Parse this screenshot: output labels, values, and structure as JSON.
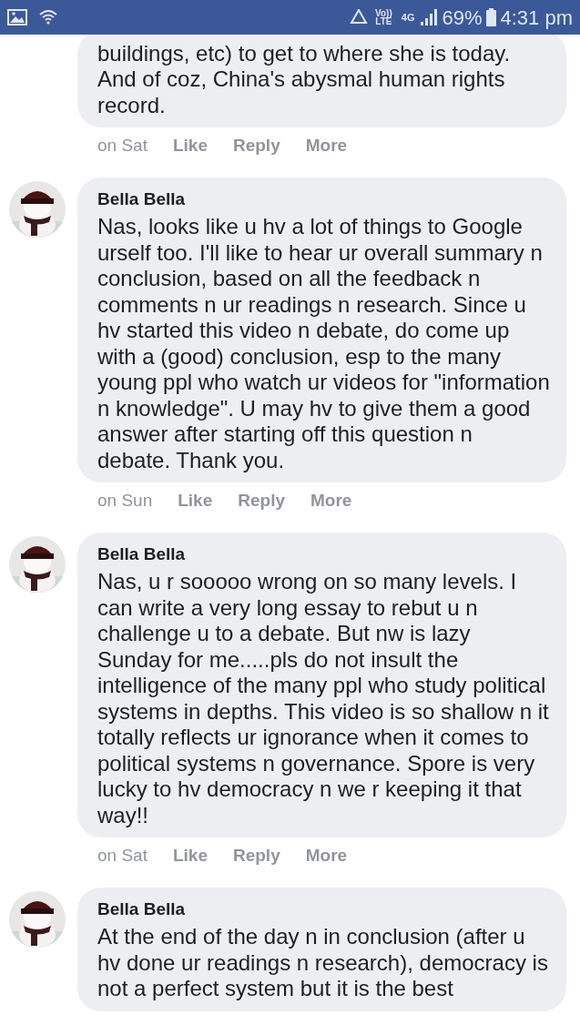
{
  "status_bar": {
    "network": "Vo))",
    "network_sub": "LTE",
    "data": "4G",
    "battery": "69%",
    "time": "4:31 pm"
  },
  "comments": [
    {
      "clipped_text": "buildings, etc) to get to where she is today.",
      "text": "And of coz, China's abysmal human rights record.",
      "time": "on Sat",
      "actions": [
        "Like",
        "Reply",
        "More"
      ]
    },
    {
      "author": "Bella Bella",
      "text": "Nas, looks like u hv a lot of things to Google urself too. I'll like to hear ur overall summary n conclusion, based on all the feedback n comments n ur readings n research. Since u hv started this video n debate, do come up with a (good) conclusion, esp to the many young ppl who watch ur videos for \"information n knowledge\". U may hv to give them a good answer after starting off this question n debate. Thank you.",
      "time": "on Sun",
      "actions": [
        "Like",
        "Reply",
        "More"
      ]
    },
    {
      "author": "Bella Bella",
      "text": "Nas, u r sooooo wrong on so many levels. I can write a very long essay to rebut u n challenge u to a debate. But nw is lazy Sunday for me.....pls do not insult the intelligence of the many ppl who study political systems in depths. This video is so shallow n it totally reflects ur ignorance when it comes to political systems n governance. Spore is very lucky to hv democracy n we r keeping it that way!!",
      "time": "on Sat",
      "actions": [
        "Like",
        "Reply",
        "More"
      ]
    },
    {
      "author": "Bella Bella",
      "text": "At the end of the day n in conclusion (after u hv done ur readings n research), democracy is not a perfect system but it is the best"
    }
  ]
}
